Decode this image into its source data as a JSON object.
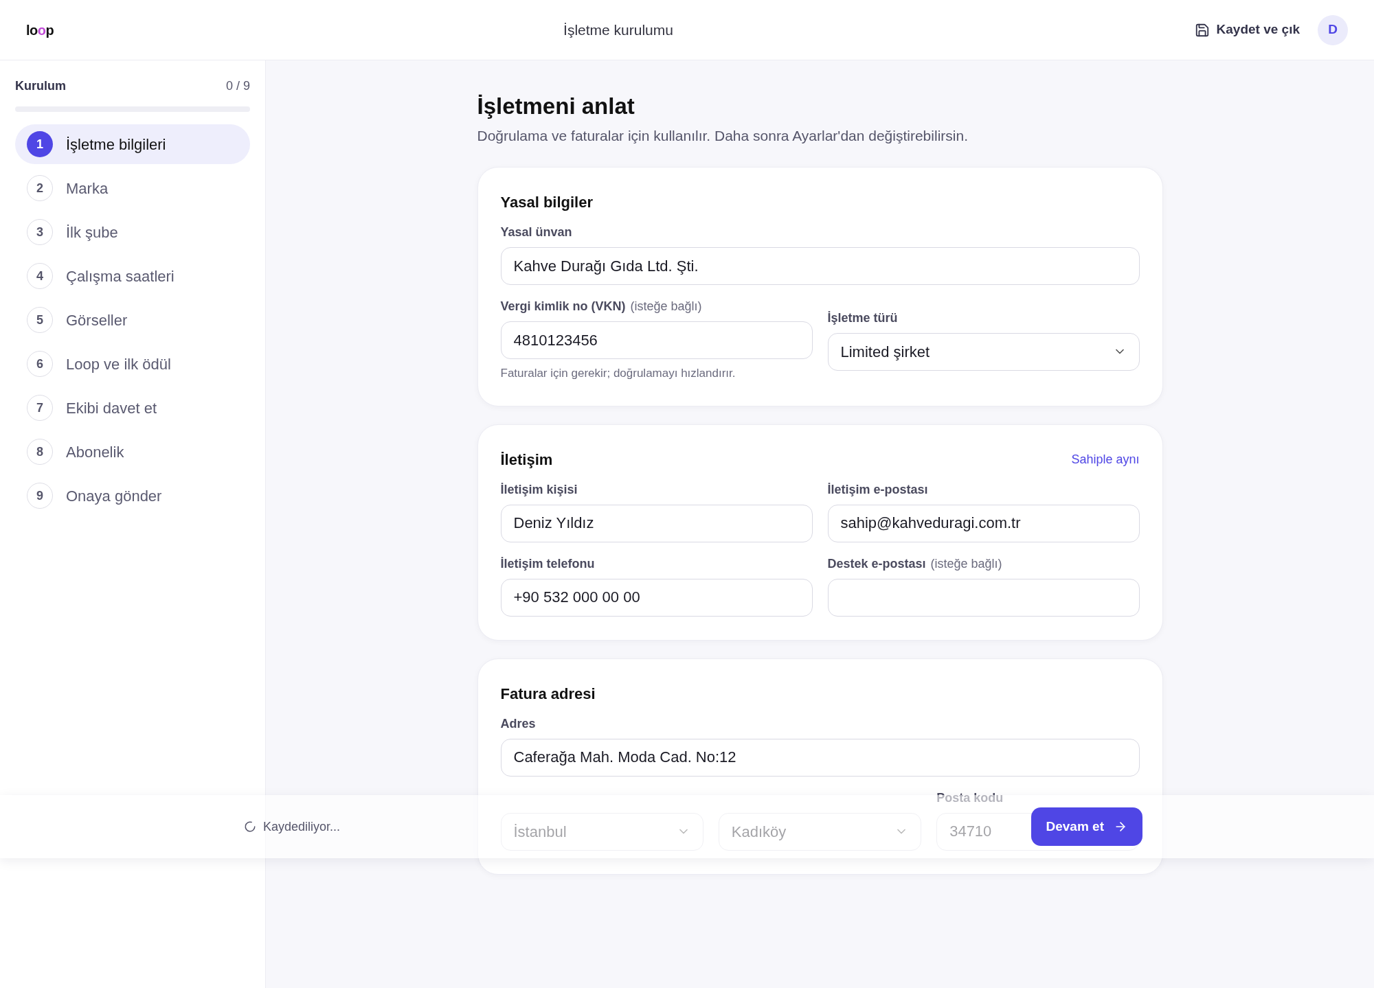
{
  "header": {
    "logo": "loop",
    "title": "İşletme kurulumu",
    "save_button": "Kaydet ve çık",
    "avatar": "D"
  },
  "sidebar": {
    "title": "Kurulum",
    "progress": "0 / 9",
    "level": 0,
    "steps": [
      {
        "number": "1",
        "label": "İşletme bilgileri",
        "selected": true
      },
      {
        "number": "2",
        "label": "Marka",
        "selected": false
      },
      {
        "number": "3",
        "label": "İlk şube",
        "selected": false
      },
      {
        "number": "4",
        "label": "Çalışma saatleri",
        "selected": false
      },
      {
        "number": "5",
        "label": "Görseller",
        "selected": false
      },
      {
        "number": "6",
        "label": "Loop ve ilk ödül",
        "selected": false
      },
      {
        "number": "7",
        "label": "Ekibi davet et",
        "selected": false
      },
      {
        "number": "8",
        "label": "Abonelik",
        "selected": false
      },
      {
        "number": "9",
        "label": "Onaya gönder",
        "selected": false
      }
    ]
  },
  "page": {
    "title": "İşletmeni anlat",
    "subtitle": "Doğrulama ve faturalar için kullanılır. Daha sonra Ayarlar'dan değiştirebilirsin."
  },
  "sections": [
    {
      "title": "Yasal bilgiler",
      "rows": [
        [
          {
            "kind": "input",
            "label": "Yasal ünvan",
            "value": "Kahve Durağı Gıda Ltd. Şti."
          }
        ],
        [
          {
            "kind": "input",
            "label": "Vergi kimlik no (VKN)",
            "note": "(isteğe bağlı)",
            "value": "4810123456",
            "hint": "Faturalar için gerekir; doğrulamayı hızlandırır."
          },
          {
            "kind": "select",
            "label": "İşletme türü",
            "value": "Limited şirket"
          }
        ]
      ]
    },
    {
      "title": "İletişim",
      "action": "Sahiple aynı",
      "rows": [
        [
          {
            "kind": "input",
            "label": "İletişim kişisi",
            "value": "Deniz Yıldız"
          },
          {
            "kind": "input",
            "label": "İletişim e-postası",
            "value": "sahip@kahveduragi.com.tr"
          }
        ],
        [
          {
            "kind": "input",
            "label": "İletişim telefonu",
            "value": "+90 532 000 00 00"
          },
          {
            "kind": "input",
            "label": "Destek e-postası",
            "note": "(isteğe bağlı)"
          }
        ]
      ]
    },
    {
      "title": "Fatura adresi",
      "rows": [
        [
          {
            "kind": "input",
            "label": "Adres",
            "value": "Caferağa Mah. Moda Cad. No:12"
          }
        ],
        [
          {
            "kind": "select",
            "value": "İstanbul"
          },
          {
            "kind": "select",
            "value": "Kadıköy"
          },
          {
            "kind": "input",
            "label": "Posta kodu",
            "value": "34710"
          }
        ]
      ]
    }
  ],
  "footer": {
    "status": "Kaydediliyor...",
    "next_button": "Devam et"
  }
}
